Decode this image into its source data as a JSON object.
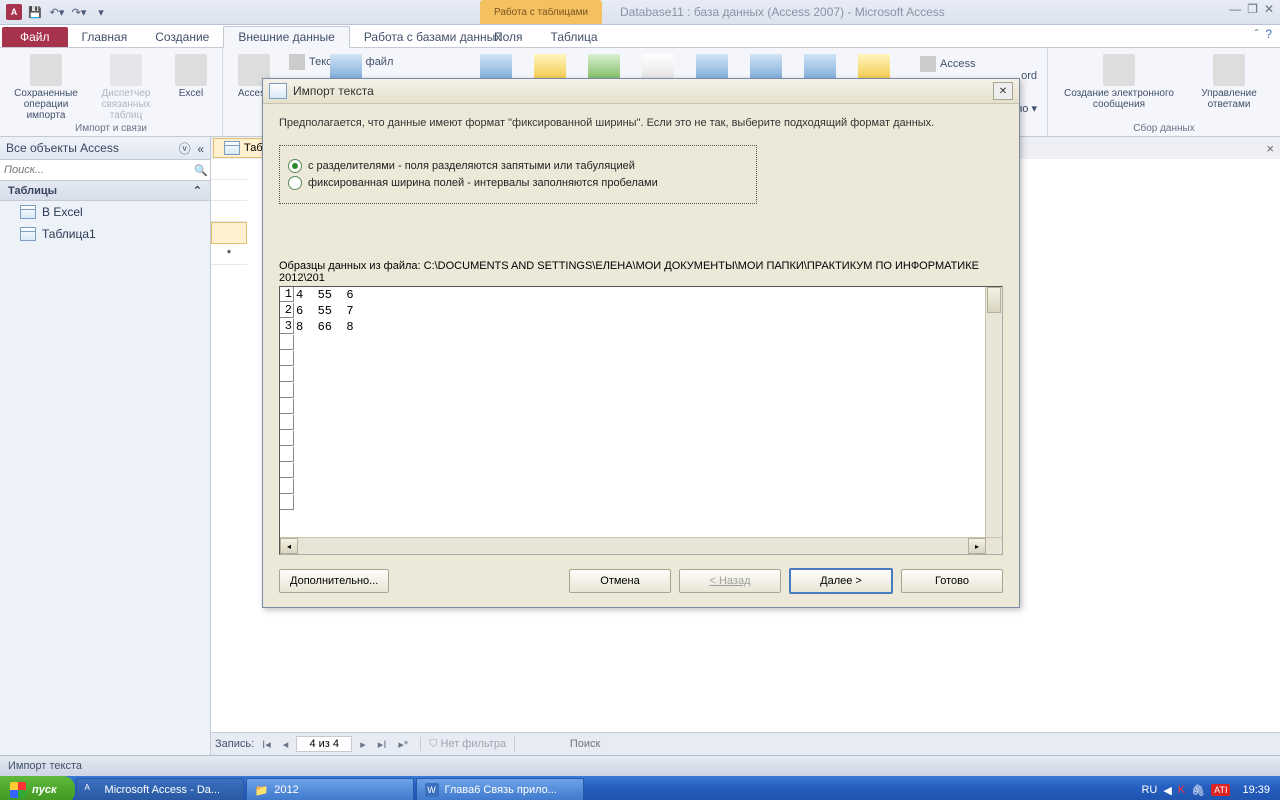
{
  "titlebar": {
    "context_label": "Работа с таблицами",
    "app_title": "Database11 : база данных (Access 2007)  -  Microsoft Access"
  },
  "tabs": {
    "file": "Файл",
    "items": [
      "Главная",
      "Создание",
      "Внешние данные",
      "Работа с базами данных"
    ],
    "active_index": 2,
    "context": [
      "Поля",
      "Таблица"
    ]
  },
  "ribbon": {
    "group1": {
      "label": "Импорт и связи",
      "btn_saved": "Сохраненные операции импорта",
      "btn_mgr": "Диспетчер связанных таблиц",
      "btn_excel": "Excel",
      "btn_text": "Текстовый файл"
    },
    "right_partial": "ord",
    "right_partial2": "ьно ▾",
    "group_collect": {
      "label": "Сбор данных",
      "btn_msg": "Создание электронного сообщения",
      "btn_ans": "Управление ответами"
    },
    "access_btn": "Access"
  },
  "nav": {
    "header": "Все объекты Access",
    "search_ph": "Поиск...",
    "cat": "Таблицы",
    "items": [
      "В Excel",
      "Таблица1"
    ]
  },
  "doc": {
    "tab": "Таб"
  },
  "record_nav": {
    "label": "Запись:",
    "pos": "4 из 4",
    "nofilter": "Нет фильтра",
    "search": "Поиск"
  },
  "statusbar": {
    "text": "Импорт текста"
  },
  "taskbar": {
    "start": "пуск",
    "items": [
      "Microsoft Access - Da...",
      "2012",
      "Глава6 Связь прило..."
    ],
    "lang": "RU",
    "time": "19:39"
  },
  "dialog": {
    "title": "Импорт текста",
    "desc": "Предполагается, что данные имеют формат \"фиксированной ширины\". Если это не так, выберите подходящий формат данных.",
    "opt1": "с разделителями - поля разделяются запятыми или табуляцией",
    "opt2": "фиксированная ширина полей - интервалы заполняются пробелами",
    "sample_label": "Образцы данных из файла: C:\\DOCUMENTS AND SETTINGS\\ЕЛЕНА\\МОИ ДОКУМЕНТЫ\\МОИ ПАПКИ\\ПРАКТИКУМ ПО ИНФОРМАТИКЕ 2012\\201",
    "sample_rows": [
      {
        "n": "1",
        "t": "4  55  6"
      },
      {
        "n": "2",
        "t": "6  55  7"
      },
      {
        "n": "3",
        "t": "8  66  8"
      }
    ],
    "btn_adv": "Дополнительно...",
    "btn_cancel": "Отмена",
    "btn_back": "< Назад",
    "btn_next": "Далее >",
    "btn_finish": "Готово"
  }
}
